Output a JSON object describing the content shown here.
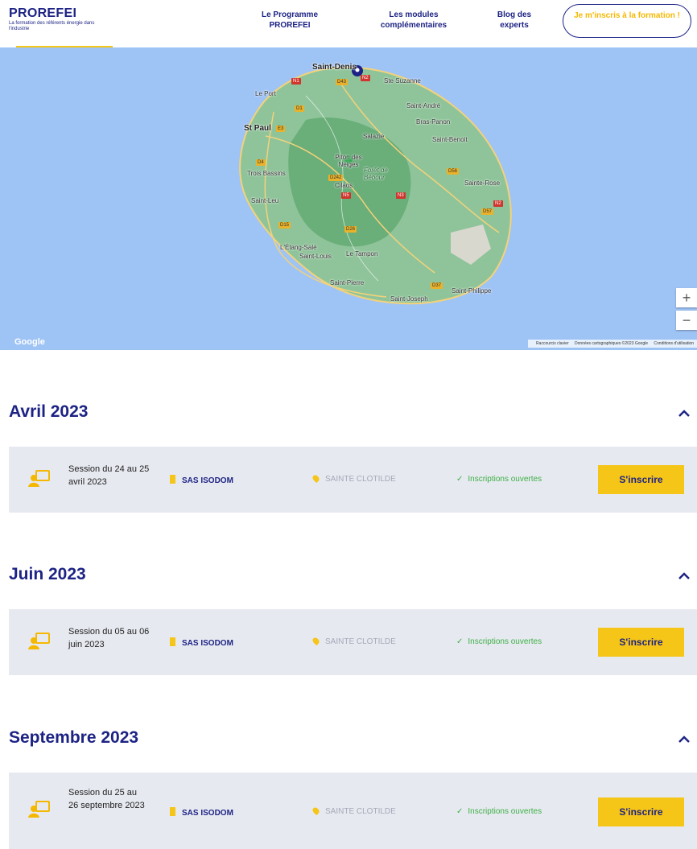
{
  "header": {
    "logo_title": "PROREFEI",
    "logo_subtitle": "La formation des référents énergie dans l'industrie",
    "nav": [
      {
        "label": "Le Programme PROREFEI"
      },
      {
        "label": "Les modules complémentaires"
      },
      {
        "label": "Blog des experts"
      }
    ],
    "cta_label": "Je m'inscris à la formation !"
  },
  "map": {
    "places": [
      "Saint-Denis",
      "Ste Suzanne",
      "Le Port",
      "Saint-André",
      "Bras-Panon",
      "St Paul",
      "Salazie",
      "Saint-Benoit",
      "Piton des Neiges",
      "Forêt de Bébour",
      "Trois Bassins",
      "Cilaos",
      "Sainte-Rose",
      "Saint-Leu",
      "L'Étang-Salé",
      "Saint-Louis",
      "Le Tampon",
      "Saint-Pierre",
      "Saint-Philippe",
      "Saint-Joseph"
    ],
    "roads": [
      "N1",
      "D43",
      "N2",
      "D1",
      "E3",
      "D4",
      "D242",
      "N5",
      "N3",
      "D56",
      "N2",
      "D57",
      "D15",
      "D26",
      "D37"
    ],
    "zoom_in": "+",
    "zoom_out": "−",
    "google_logo": "Google",
    "attribution": [
      "Raccourcis clavier",
      "Données cartographiques ©2023 Google",
      "Conditions d'utilisation"
    ]
  },
  "sessions_by_month": [
    {
      "month": "Avril 2023",
      "session": "Session du 24 au 25 avril 2023",
      "organizer": "SAS ISODOM",
      "location": "SAINTE CLOTILDE",
      "status": "Inscriptions ouvertes",
      "button": "S'inscrire"
    },
    {
      "month": "Juin 2023",
      "session": "Session du 05 au 06 juin 2023",
      "organizer": "SAS ISODOM",
      "location": "SAINTE CLOTILDE",
      "status": "Inscriptions ouvertes",
      "button": "S'inscrire"
    },
    {
      "month": "Septembre 2023",
      "session": "Session du 25 au 26 septembre 2023",
      "organizer": "SAS ISODOM",
      "location": "SAINTE CLOTILDE",
      "status": "Inscriptions ouvertes",
      "button": "S'inscrire"
    }
  ],
  "colors": {
    "brand_navy": "#1d2384",
    "accent_yellow": "#f5c518",
    "status_green": "#3cb043",
    "card_bg": "#e7e9f1",
    "map_sea": "#9ec3f5"
  }
}
